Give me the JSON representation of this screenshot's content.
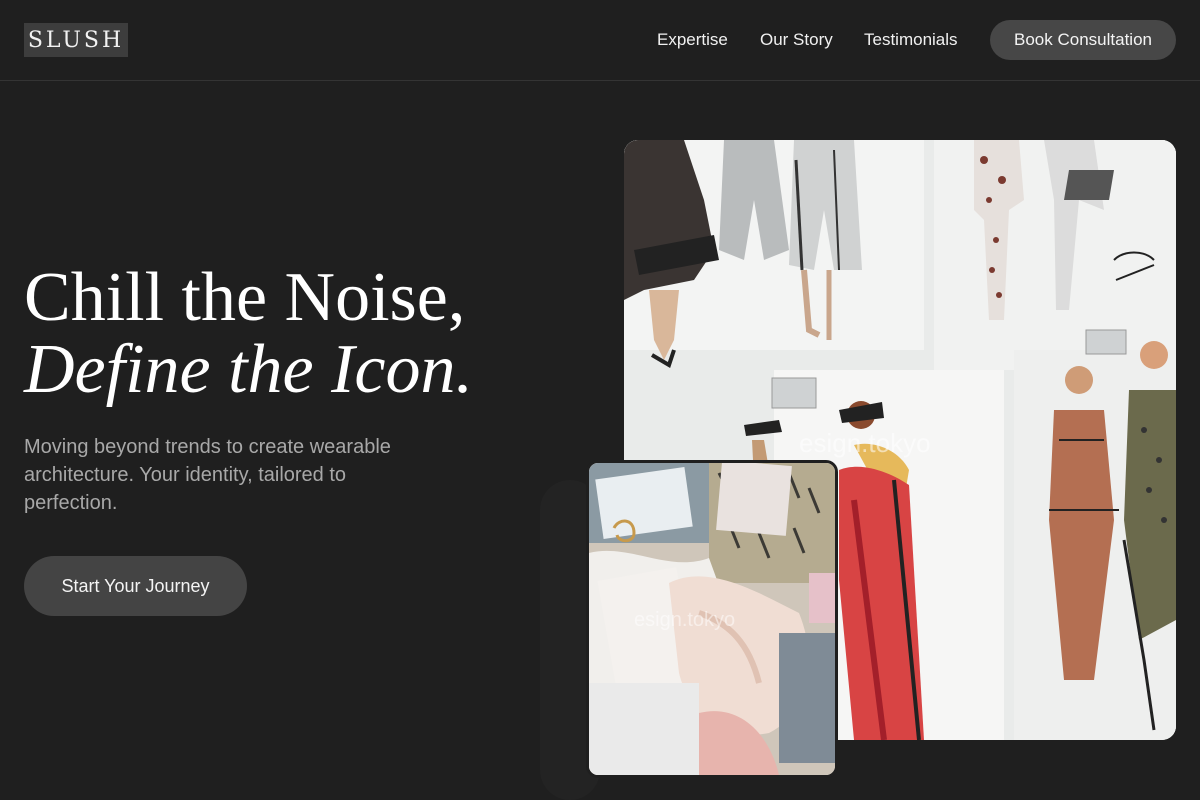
{
  "header": {
    "logo": "SLUSH",
    "nav": [
      "Expertise",
      "Our Story",
      "Testimonials"
    ],
    "cta": "Book Consultation"
  },
  "hero": {
    "headline_line1": "Chill the Noise,",
    "headline_line2": "Define the Icon.",
    "subtitle": "Moving beyond trends to create wearable architecture. Your identity, tailored to perfection.",
    "cta": "Start Your Journey"
  },
  "images": {
    "main_watermark": "esign.tokyo",
    "inset_watermark": "esign.tokyo"
  }
}
